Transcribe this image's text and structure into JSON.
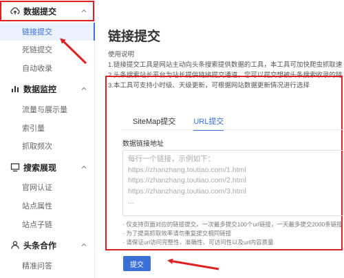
{
  "sidebar": {
    "groups": [
      {
        "label": "数据提交",
        "icon": "cloud-upload-icon",
        "items": [
          "链接提交",
          "死链提交",
          "自动收录"
        ]
      },
      {
        "label": "数据监控",
        "icon": "bar-chart-icon",
        "items": [
          "流量与展示量",
          "索引量",
          "抓取频次"
        ]
      },
      {
        "label": "搜索展现",
        "icon": "monitor-icon",
        "items": [
          "官网认证",
          "站点属性",
          "站点子链"
        ]
      },
      {
        "label": "头条合作",
        "icon": "user-icon",
        "items": [
          "精准问答"
        ]
      }
    ],
    "active_item": "链接提交"
  },
  "main": {
    "title": "链接提交",
    "notes": [
      "使用说明",
      "1.链接提交工具是网站主动向头条搜索提供数据的工具，本工具可加快爬虫抓取速",
      "2.头条搜索站长平台为站长提供链接提交通道，您可以提交想被头条搜索收录的链",
      "3.本工具可支持小时级、天级更新，可根据网站数据更新情况进行选择"
    ],
    "tabs": [
      "SiteMap提交",
      "URL提交"
    ],
    "active_tab": "URL提交",
    "field_label": "数据链接地址",
    "textarea_lines": [
      "每行一个链接，示例如下：",
      "https://zhanzhang.toutiao.com/1.html",
      "https://zhanzhang.toutiao.com/2.html",
      "https://zhanzhang.toutiao.com/3.html",
      "..."
    ],
    "hints": [
      "· 仅支持页面对应的链接提交。一次最多提交100个url链接，一天最多提交2000条链接",
      "· 为了提高抓取效率请勿重复提交相同链接",
      "· 请保证url访问完整性、准确性、可访问性以及url内容质量"
    ],
    "submit_label": "提交"
  },
  "colors": {
    "accent": "#3a6fd8",
    "annotation": "#e02020"
  }
}
